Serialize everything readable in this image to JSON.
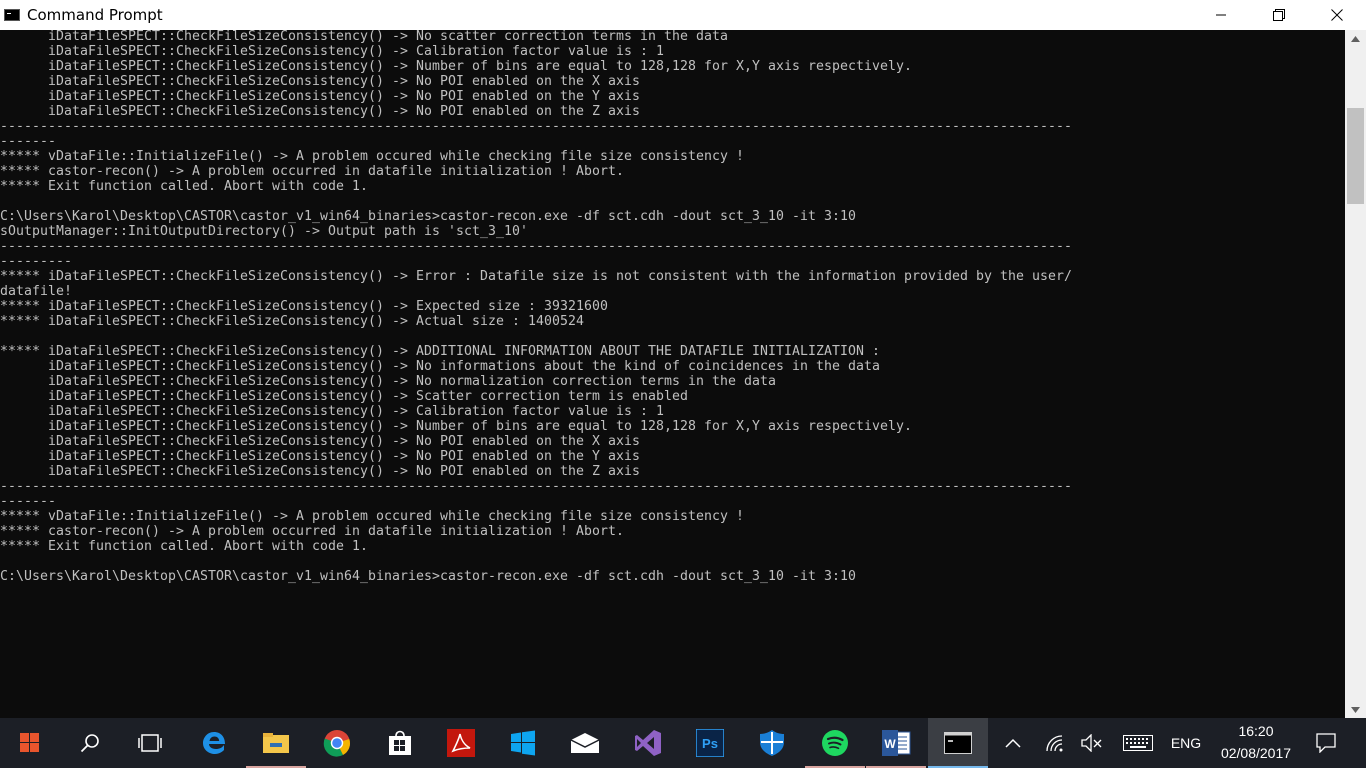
{
  "window": {
    "title": "Command Prompt",
    "minimize_glyph": "—",
    "maximize_glyph": "❐",
    "close_glyph": "✕"
  },
  "console": {
    "lines": [
      "      iDataFileSPECT::CheckFileSizeConsistency() -> No scatter correction terms in the data",
      "      iDataFileSPECT::CheckFileSizeConsistency() -> Calibration factor value is : 1",
      "      iDataFileSPECT::CheckFileSizeConsistency() -> Number of bins are equal to 128,128 for X,Y axis respectively.",
      "      iDataFileSPECT::CheckFileSizeConsistency() -> No POI enabled on the X axis",
      "      iDataFileSPECT::CheckFileSizeConsistency() -> No POI enabled on the Y axis",
      "      iDataFileSPECT::CheckFileSizeConsistency() -> No POI enabled on the Z axis",
      "--------------------------------------------------------------------------------------------------------------------------------------",
      "-------",
      "***** vDataFile::InitializeFile() -> A problem occured while checking file size consistency !",
      "***** castor-recon() -> A problem occurred in datafile initialization ! Abort.",
      "***** Exit function called. Abort with code 1.",
      "",
      "C:\\Users\\Karol\\Desktop\\CASTOR\\castor_v1_win64_binaries>castor-recon.exe -df sct.cdh -dout sct_3_10 -it 3:10",
      "sOutputManager::InitOutputDirectory() -> Output path is 'sct_3_10'",
      "--------------------------------------------------------------------------------------------------------------------------------------",
      "---------",
      "***** iDataFileSPECT::CheckFileSizeConsistency() -> Error : Datafile size is not consistent with the information provided by the user/",
      "datafile!",
      "***** iDataFileSPECT::CheckFileSizeConsistency() -> Expected size : 39321600",
      "***** iDataFileSPECT::CheckFileSizeConsistency() -> Actual size : 1400524",
      "",
      "***** iDataFileSPECT::CheckFileSizeConsistency() -> ADDITIONAL INFORMATION ABOUT THE DATAFILE INITIALIZATION :",
      "      iDataFileSPECT::CheckFileSizeConsistency() -> No informations about the kind of coincidences in the data",
      "      iDataFileSPECT::CheckFileSizeConsistency() -> No normalization correction terms in the data",
      "      iDataFileSPECT::CheckFileSizeConsistency() -> Scatter correction term is enabled",
      "      iDataFileSPECT::CheckFileSizeConsistency() -> Calibration factor value is : 1",
      "      iDataFileSPECT::CheckFileSizeConsistency() -> Number of bins are equal to 128,128 for X,Y axis respectively.",
      "      iDataFileSPECT::CheckFileSizeConsistency() -> No POI enabled on the X axis",
      "      iDataFileSPECT::CheckFileSizeConsistency() -> No POI enabled on the Y axis",
      "      iDataFileSPECT::CheckFileSizeConsistency() -> No POI enabled on the Z axis",
      "--------------------------------------------------------------------------------------------------------------------------------------",
      "-------",
      "***** vDataFile::InitializeFile() -> A problem occured while checking file size consistency !",
      "***** castor-recon() -> A problem occurred in datafile initialization ! Abort.",
      "***** Exit function called. Abort with code 1.",
      "",
      "C:\\Users\\Karol\\Desktop\\CASTOR\\castor_v1_win64_binaries>castor-recon.exe -df sct.cdh -dout sct_3_10 -it 3:10"
    ]
  },
  "taskbar": {
    "apps": [
      {
        "name": "start",
        "icon": "windows-start-icon"
      },
      {
        "name": "search",
        "icon": "search-icon"
      },
      {
        "name": "task-view",
        "icon": "task-view-icon"
      },
      {
        "name": "edge",
        "icon": "edge-icon"
      },
      {
        "name": "file-explorer",
        "icon": "folder-icon"
      },
      {
        "name": "chrome",
        "icon": "chrome-icon"
      },
      {
        "name": "store",
        "icon": "store-icon"
      },
      {
        "name": "acrobat",
        "icon": "acrobat-icon"
      },
      {
        "name": "windows",
        "icon": "windows-logo-icon"
      },
      {
        "name": "mail",
        "icon": "mail-icon"
      },
      {
        "name": "visual-studio",
        "icon": "visual-studio-icon"
      },
      {
        "name": "photoshop",
        "icon": "photoshop-icon"
      },
      {
        "name": "defender",
        "icon": "shield-icon"
      },
      {
        "name": "spotify",
        "icon": "spotify-icon"
      },
      {
        "name": "word",
        "icon": "word-icon"
      },
      {
        "name": "command-prompt",
        "icon": "cmd-icon"
      }
    ],
    "photoshop_label": "Ps",
    "word_label": "W",
    "language": "ENG",
    "time": "16:20",
    "date": "02/08/2017",
    "accent": "#0078d7"
  }
}
